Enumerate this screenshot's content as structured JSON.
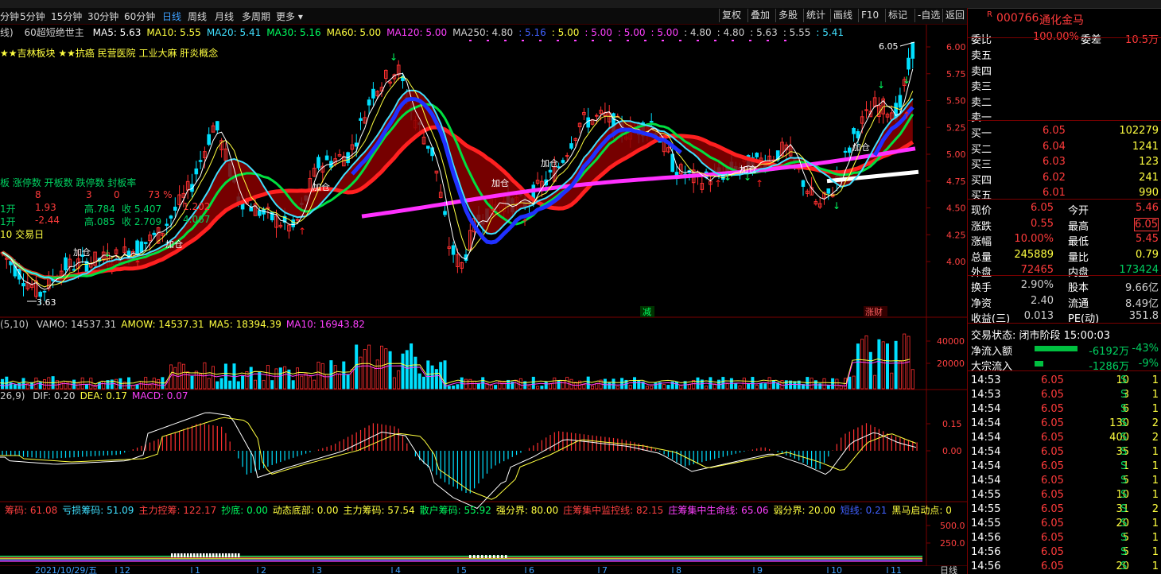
{
  "period_tabs": [
    "分钟",
    "5分钟",
    "15分钟",
    "30分钟",
    "60分钟",
    "日线",
    "周线",
    "月线",
    "多周期",
    "更多 ▾"
  ],
  "active_period": "日线",
  "toolbar": [
    "复权",
    "叠加",
    "多股",
    "统计",
    "画线",
    "F10",
    "标记",
    "-自选",
    "返回"
  ],
  "main_legend": {
    "prefix": "线)",
    "strategy": "60超短绝世主",
    "items": [
      {
        "label": "MA5: 5.63",
        "color": "#ffffff"
      },
      {
        "label": "MA10: 5.55",
        "color": "#ffff40"
      },
      {
        "label": "MA20: 5.41",
        "color": "#40e0ff"
      },
      {
        "label": "MA30: 5.16",
        "color": "#00ff60"
      },
      {
        "label": "MA60: 5.00",
        "color": "#ffff40"
      },
      {
        "label": "MA120: 5.00",
        "color": "#ff40ff"
      },
      {
        "label": "MA250: 4.80",
        "color": "#d0d0d0"
      },
      {
        "label": ": 5.16",
        "color": "#4060ff"
      },
      {
        "label": ": 5.00",
        "color": "#ffff40"
      },
      {
        "label": ": 5.00",
        "color": "#ff40ff"
      },
      {
        "label": ": 5.00",
        "color": "#ff40ff"
      },
      {
        "label": ": 5.00",
        "color": "#ff40ff"
      },
      {
        "label": ": 4.80",
        "color": "#d0d0d0"
      },
      {
        "label": ": 4.80",
        "color": "#d0d0d0"
      },
      {
        "label": ": 5.63",
        "color": "#d0d0d0"
      },
      {
        "label": ": 5.55",
        "color": "#d0d0d0"
      },
      {
        "label": ": 5.41",
        "color": "#40e0ff"
      }
    ]
  },
  "concepts": "★★吉林板块 ★★抗癌 民营医院 工业大麻 肝炎概念",
  "limit_panel": {
    "header": "板 涨停数 开板数 跌停数 封板率",
    "values": [
      "8",
      "3",
      "0",
      "73 %"
    ],
    "row2": [
      "1开",
      "1.93",
      "高.784",
      "收 5.407",
      "1.202"
    ],
    "row3": [
      "1开",
      "-2.44",
      "高.085",
      "收 2.709",
      "4.067"
    ],
    "row4": "10 交易日"
  },
  "price_axis": [
    "6.00",
    "5.75",
    "5.50",
    "5.25",
    "5.00",
    "4.75",
    "4.50",
    "4.25",
    "4.00"
  ],
  "high_label": "6.05",
  "low_label": "3.63",
  "tags": [
    "减",
    "涨财"
  ],
  "chart_labels": [
    "加仓",
    "加仓",
    "加仓",
    "加仓",
    "加仓",
    "加仓",
    "加仓"
  ],
  "vol_legend": {
    "prefix": "(5,10)",
    "items": [
      {
        "label": "VAMO: 14537.31",
        "color": "#d0d0d0"
      },
      {
        "label": "AMOW: 14537.31",
        "color": "#ffff40"
      },
      {
        "label": "MA5: 18394.39",
        "color": "#ffff40"
      },
      {
        "label": "MA10: 16943.82",
        "color": "#ff40ff"
      }
    ]
  },
  "vol_axis": [
    "40000",
    "20000"
  ],
  "macd_legend": {
    "prefix": "26,9)",
    "items": [
      {
        "label": "DIF: 0.20",
        "color": "#d0d0d0"
      },
      {
        "label": "DEA: 0.17",
        "color": "#ffff40"
      },
      {
        "label": "MACD: 0.07",
        "color": "#ff40ff"
      }
    ]
  },
  "macd_axis": [
    "0.15",
    "0.00"
  ],
  "chip_legend": [
    {
      "label": "筹码: 61.08",
      "color": "#ff4040"
    },
    {
      "label": "亏损筹码: 51.09",
      "color": "#40e0ff"
    },
    {
      "label": "主力控筹: 122.17",
      "color": "#ff4040"
    },
    {
      "label": "抄底: 0.00",
      "color": "#00ff60"
    },
    {
      "label": "动态底部: 0.00",
      "color": "#ffff40"
    },
    {
      "label": "主力筹码: 57.54",
      "color": "#ffff40"
    },
    {
      "label": "散户筹码: 55.92",
      "color": "#00ff60"
    },
    {
      "label": "强分界: 80.00",
      "color": "#ffff40"
    },
    {
      "label": "庄筹集中监控线: 82.15",
      "color": "#ff4040"
    },
    {
      "label": "庄筹集中生命线: 65.06",
      "color": "#ff40ff"
    },
    {
      "label": "弱分界: 20.00",
      "color": "#ffff40"
    },
    {
      "label": "短线: 0.21",
      "color": "#4060ff"
    },
    {
      "label": "黑马启动点: 0",
      "color": "#ffff40"
    }
  ],
  "chip_axis": [
    "500.0",
    "250.0"
  ],
  "date_axis": {
    "first": "2021/10/29/五",
    "months": [
      "12",
      "1",
      "2",
      "3",
      "4",
      "5",
      "6",
      "7",
      "8",
      "9",
      "10",
      "11"
    ]
  },
  "bottom_tab": "日线",
  "stock": {
    "flag": "R",
    "code": "000766",
    "name": "通化金马"
  },
  "order_book": {
    "weibi_label": "委比",
    "weibi": "100.00%",
    "weicha_label": "委差",
    "weicha": "10.5万",
    "sells": [
      "卖五",
      "卖四",
      "卖三",
      "卖二",
      "卖一"
    ],
    "buys": [
      {
        "label": "买一",
        "price": "6.05",
        "vol": "102279"
      },
      {
        "label": "买二",
        "price": "6.04",
        "vol": "1241"
      },
      {
        "label": "买三",
        "price": "6.03",
        "vol": "123"
      },
      {
        "label": "买四",
        "price": "6.02",
        "vol": "241"
      },
      {
        "label": "买五",
        "price": "6.01",
        "vol": "990"
      }
    ]
  },
  "quote": [
    {
      "l1": "现价",
      "v1": "6.05",
      "c1": "red",
      "l2": "今开",
      "v2": "5.46",
      "c2": "red"
    },
    {
      "l1": "涨跌",
      "v1": "0.55",
      "c1": "red",
      "l2": "最高",
      "v2": "6.05",
      "c2": "red"
    },
    {
      "l1": "涨幅",
      "v1": "10.00%",
      "c1": "red",
      "l2": "最低",
      "v2": "5.45",
      "c2": "red"
    },
    {
      "l1": "总量",
      "v1": "245889",
      "c1": "yellow",
      "l2": "量比",
      "v2": "0.79",
      "c2": "yellow"
    },
    {
      "l1": "外盘",
      "v1": "72465",
      "c1": "red",
      "l2": "内盘",
      "v2": "173424",
      "c2": "green"
    },
    {
      "l1": "换手",
      "v1": "2.90%",
      "c1": "gray",
      "l2": "股本",
      "v2": "9.66亿",
      "c2": "gray"
    },
    {
      "l1": "净资",
      "v1": "2.40",
      "c1": "gray",
      "l2": "流通",
      "v2": "8.49亿",
      "c2": "gray"
    },
    {
      "l1": "收益(三)",
      "v1": "0.013",
      "c1": "gray",
      "l2": "PE(动)",
      "v2": "351.8",
      "c2": "gray"
    }
  ],
  "trade_status": "交易状态: 闭市阶段 15:00:03",
  "flows": [
    {
      "label": "净流入额",
      "value": "-6192万",
      "pct": "-43%",
      "bar": 0.43
    },
    {
      "label": "大宗流入",
      "value": "-1286万",
      "pct": "-9%",
      "bar": 0.09
    }
  ],
  "ticks": [
    {
      "t": "14:53",
      "p": "6.05",
      "v": "10",
      "s": "S",
      "n": "1"
    },
    {
      "t": "14:53",
      "p": "6.05",
      "v": "3",
      "s": "S",
      "n": "1"
    },
    {
      "t": "14:54",
      "p": "6.05",
      "v": "6",
      "s": "S",
      "n": "1"
    },
    {
      "t": "14:54",
      "p": "6.05",
      "v": "130",
      "s": "S",
      "n": "2"
    },
    {
      "t": "14:54",
      "p": "6.05",
      "v": "400",
      "s": "S",
      "n": "2"
    },
    {
      "t": "14:54",
      "p": "6.05",
      "v": "35",
      "s": "S",
      "n": "1"
    },
    {
      "t": "14:54",
      "p": "6.05",
      "v": "1",
      "s": "S",
      "n": "1"
    },
    {
      "t": "14:54",
      "p": "6.05",
      "v": "5",
      "s": "S",
      "n": "1"
    },
    {
      "t": "14:55",
      "p": "6.05",
      "v": "10",
      "s": "S",
      "n": "1"
    },
    {
      "t": "14:55",
      "p": "6.05",
      "v": "31",
      "s": "S",
      "n": "2"
    },
    {
      "t": "14:55",
      "p": "6.05",
      "v": "20",
      "s": "S",
      "n": "1"
    },
    {
      "t": "14:56",
      "p": "6.05",
      "v": "5",
      "s": "S",
      "n": "1"
    },
    {
      "t": "14:56",
      "p": "6.05",
      "v": "5",
      "s": "S",
      "n": "1"
    },
    {
      "t": "14:56",
      "p": "6.05",
      "v": "20",
      "s": "S",
      "n": "1"
    }
  ]
}
